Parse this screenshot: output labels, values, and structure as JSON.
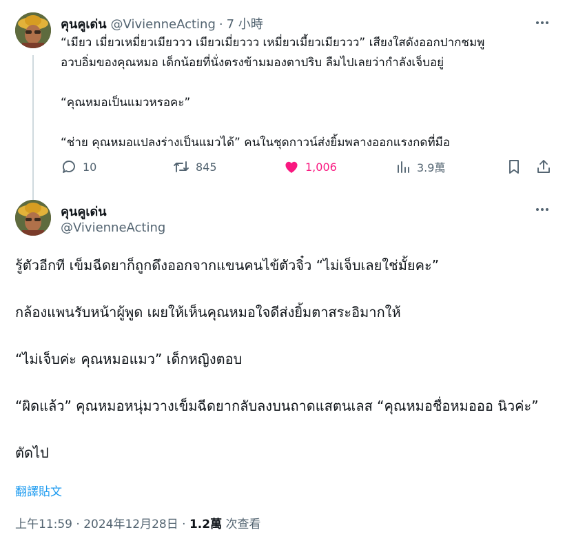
{
  "reply_parent": {
    "author_name": "คุนคูเด่น",
    "handle": "@VivienneActing",
    "separator": "·",
    "time": "7 小時",
    "paragraphs": [
      "“เมียว เมี่ยวเหมี่ยวเมียววว เมียวเมี่ยววว เหมี่ยวเมี้ยวเมียววว” เสียงใสดังออกปากชมพู",
      "อวบอิ่มของคุณหมอ เด็กน้อยที่นั่งตรงข้ามมองตาปริบ ลืมไปเลยว่ากำลังเจ็บอยู่",
      "“คุณหมอเป็นแมวหรอคะ”",
      "“ช่าย คุณหมอแปลงร่างเป็นแมวได้” คนในชุดกาวน์ส่งยิ้มพลางออกแรงกดที่มือ"
    ],
    "actions": {
      "replies": "10",
      "retweets": "845",
      "likes": "1,006",
      "views": "3.9萬"
    }
  },
  "main_tweet": {
    "author_name": "คุนคูเด่น",
    "handle": "@VivienneActing",
    "paragraphs": [
      "รู้ตัวอีกที เข็มฉีดยาก็ถูกดึงออกจากแขนคนไข้ตัวจิ๋ว “ไม่เจ็บเลยใช่มั้ยคะ”",
      "กล้องแพนรับหน้าผู้พูด เผยให้เห็นคุณหมอใจดีส่งยิ้มตาสระอิมากให้",
      "“ไม่เจ็บค่ะ คุณหมอแมว” เด็กหญิงตอบ",
      "“ผิดแล้ว” คุณหมอหนุ่มวางเข็มฉีดยากลับลงบนถาดแสตนเลส “คุณหมอชื่อหมอออ นิวค่ะ”",
      "ตัดไป"
    ],
    "translate_label": "翻譯貼文",
    "timestamp": "上午11:59 · 2024年12月28日",
    "separator": "·",
    "view_count": "1.2萬",
    "view_label": "次查看"
  },
  "icons": [
    "more-icon",
    "reply-icon",
    "retweet-icon",
    "like-icon",
    "views-icon",
    "bookmark-icon",
    "share-icon"
  ],
  "colors": {
    "like": "#f91880",
    "link": "#1d9bf0",
    "secondary": "#536471",
    "thread_line": "#cfd9de"
  }
}
